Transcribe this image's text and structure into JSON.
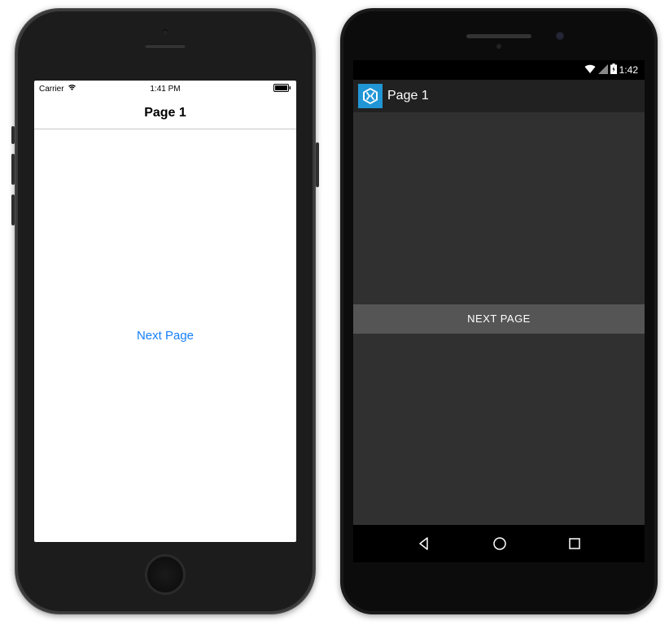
{
  "ios": {
    "statusbar": {
      "carrier": "Carrier",
      "time": "1:41 PM"
    },
    "nav": {
      "title": "Page 1"
    },
    "content": {
      "button_label": "Next Page"
    }
  },
  "android": {
    "statusbar": {
      "time": "1:42"
    },
    "actionbar": {
      "title": "Page 1"
    },
    "content": {
      "button_label": "NEXT PAGE"
    }
  }
}
